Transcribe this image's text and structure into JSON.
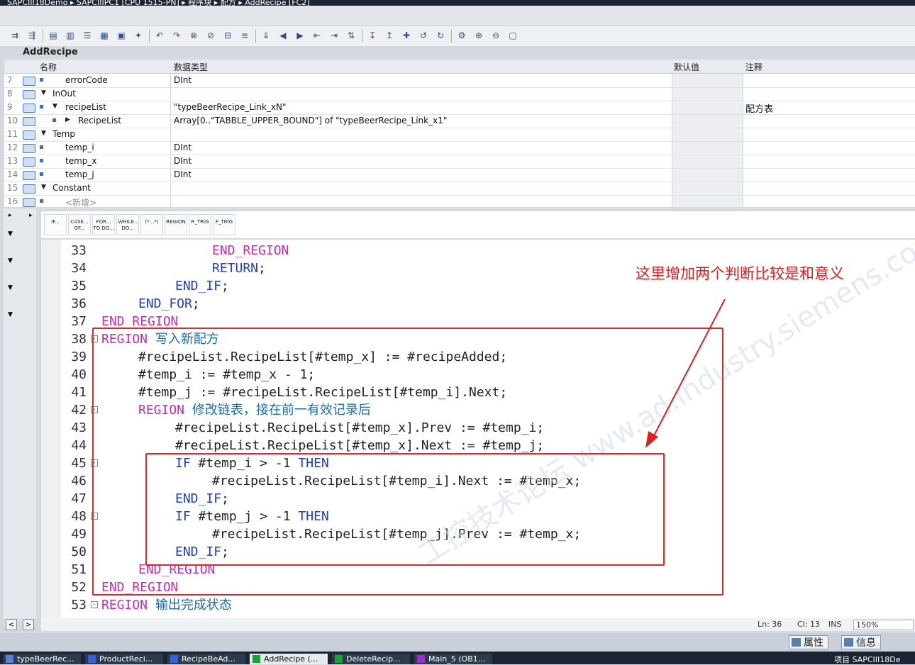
{
  "window_title": "SAPCIII18Demo ▸ SAPCIIIPC1 [CPU 1515-PN] ▸ 程序块 ▸ 配方 ▸ AddRecipe [FC2]",
  "block_name": "AddRecipe",
  "interface": {
    "headers": {
      "name": "名称",
      "datatype": "数据类型",
      "default": "默认值",
      "comment": "注释"
    },
    "rows": [
      {
        "num": "7",
        "name": "errorCode",
        "type": "DInt",
        "comment": "",
        "level": 2,
        "expand": ""
      },
      {
        "num": "8",
        "name": "InOut",
        "type": "",
        "comment": "",
        "level": 1,
        "expand": "down"
      },
      {
        "num": "9",
        "name": "recipeList",
        "type": "\"typeBeerRecipe_Link_xN\"",
        "comment": "配方表",
        "level": 2,
        "expand": "down"
      },
      {
        "num": "10",
        "name": "RecipeList",
        "type": "Array[0..\"TABBLE_UPPER_BOUND\"] of \"typeBeerRecipe_Link_x1\"",
        "comment": "",
        "level": 3,
        "expand": "right"
      },
      {
        "num": "11",
        "name": "Temp",
        "type": "",
        "comment": "",
        "level": 1,
        "expand": "down"
      },
      {
        "num": "12",
        "name": "temp_i",
        "type": "DInt",
        "comment": "",
        "level": 2,
        "expand": ""
      },
      {
        "num": "13",
        "name": "temp_x",
        "type": "DInt",
        "comment": "",
        "level": 2,
        "expand": ""
      },
      {
        "num": "14",
        "name": "temp_j",
        "type": "DInt",
        "comment": "",
        "level": 2,
        "expand": ""
      },
      {
        "num": "15",
        "name": "Constant",
        "type": "",
        "comment": "",
        "level": 1,
        "expand": "down"
      },
      {
        "num": "16",
        "name": "<新增>",
        "type": "",
        "comment": "",
        "level": 2,
        "expand": ""
      }
    ]
  },
  "scl_buttons": [
    {
      "top": "IF...",
      "bottom": ""
    },
    {
      "top": "CASE...",
      "bottom": "OF..."
    },
    {
      "top": "FOR...",
      "bottom": "TO DO..."
    },
    {
      "top": "WHILE..",
      "bottom": "DO..."
    },
    {
      "top": "(*...*)",
      "bottom": ""
    },
    {
      "top": "REGION",
      "bottom": ""
    },
    {
      "top": "R_TRIG",
      "bottom": ""
    },
    {
      "top": "F_TRIG",
      "bottom": ""
    }
  ],
  "code_lines": [
    {
      "ln": "33",
      "fold": "",
      "indent": 6,
      "parts": [
        [
          "rg",
          "END_REGION"
        ]
      ]
    },
    {
      "ln": "34",
      "fold": "",
      "indent": 6,
      "parts": [
        [
          "kw",
          "RETURN"
        ],
        [
          "t",
          ";"
        ]
      ]
    },
    {
      "ln": "35",
      "fold": "",
      "indent": 4,
      "parts": [
        [
          "kw",
          "END_IF"
        ],
        [
          "t",
          ";"
        ]
      ]
    },
    {
      "ln": "36",
      "fold": "",
      "indent": 2,
      "parts": [
        [
          "kw",
          "END_FOR"
        ],
        [
          "t",
          ";"
        ]
      ]
    },
    {
      "ln": "37",
      "fold": "",
      "indent": 0,
      "parts": [
        [
          "rg",
          "END_REGION"
        ]
      ]
    },
    {
      "ln": "38",
      "fold": "-",
      "indent": 0,
      "parts": [
        [
          "rg",
          "REGION "
        ],
        [
          "cm",
          "写入新配方"
        ]
      ]
    },
    {
      "ln": "39",
      "fold": "",
      "indent": 2,
      "parts": [
        [
          "t",
          "#recipeList.RecipeList[#temp_x] := #recipeAdded;"
        ]
      ]
    },
    {
      "ln": "40",
      "fold": "",
      "indent": 2,
      "parts": [
        [
          "t",
          "#temp_i := #temp_x - 1;"
        ]
      ]
    },
    {
      "ln": "41",
      "fold": "",
      "indent": 2,
      "parts": [
        [
          "t",
          "#temp_j := #recipeList.RecipeList[#temp_i].Next;"
        ]
      ]
    },
    {
      "ln": "42",
      "fold": "-",
      "indent": 2,
      "parts": [
        [
          "rg",
          "REGION "
        ],
        [
          "cm",
          "修改链表，接在前一有效记录后"
        ]
      ]
    },
    {
      "ln": "43",
      "fold": "",
      "indent": 4,
      "parts": [
        [
          "t",
          "#recipeList.RecipeList[#temp_x].Prev := #temp_i;"
        ]
      ]
    },
    {
      "ln": "44",
      "fold": "",
      "indent": 4,
      "parts": [
        [
          "t",
          "#recipeList.RecipeList[#temp_x].Next := #temp_j;"
        ]
      ]
    },
    {
      "ln": "45",
      "fold": "-",
      "indent": 4,
      "parts": [
        [
          "kw",
          "IF "
        ],
        [
          "t",
          "#temp_i > -1 "
        ],
        [
          "kw",
          "THEN"
        ]
      ]
    },
    {
      "ln": "46",
      "fold": "",
      "indent": 6,
      "parts": [
        [
          "t",
          "#recipeList.RecipeList[#temp_i].Next := #temp_x;"
        ]
      ]
    },
    {
      "ln": "47",
      "fold": "",
      "indent": 4,
      "parts": [
        [
          "kw",
          "END_IF"
        ],
        [
          "t",
          ";"
        ]
      ]
    },
    {
      "ln": "48",
      "fold": "-",
      "indent": 4,
      "parts": [
        [
          "kw",
          "IF "
        ],
        [
          "t",
          "#temp_j > -1 "
        ],
        [
          "kw",
          "THEN"
        ]
      ]
    },
    {
      "ln": "49",
      "fold": "",
      "indent": 6,
      "parts": [
        [
          "t",
          "#recipeList.RecipeList[#temp_j].Prev := #temp_x;"
        ]
      ]
    },
    {
      "ln": "50",
      "fold": "",
      "indent": 4,
      "parts": [
        [
          "kw",
          "END_IF"
        ],
        [
          "t",
          ";"
        ]
      ]
    },
    {
      "ln": "51",
      "fold": "",
      "indent": 2,
      "parts": [
        [
          "rg",
          "END_REGION"
        ]
      ]
    },
    {
      "ln": "52",
      "fold": "",
      "indent": 0,
      "parts": [
        [
          "rg",
          "END_REGION"
        ]
      ]
    },
    {
      "ln": "53",
      "fold": "-",
      "indent": 0,
      "parts": [
        [
          "rg",
          "REGION "
        ],
        [
          "cm",
          "输出完成状态"
        ]
      ]
    }
  ],
  "annotation": "这里增加两个判断比较是和意义",
  "watermark": "工控技术论坛  www.ad.industry.siemens.com/cs",
  "status": {
    "ln": "Ln: 36",
    "cl": "Cl: 13",
    "mode": "INS",
    "zoom": "150%"
  },
  "inspector_tabs": [
    "属性",
    "信息"
  ],
  "taskbar": [
    {
      "label": "typeBeerRec...",
      "color": "#5b7fd1"
    },
    {
      "label": "ProductReci...",
      "color": "#3c5fd0"
    },
    {
      "label": "RecipeBeAd...",
      "color": "#3c5fd0"
    },
    {
      "label": "AddRecipe (...",
      "color": "#1f9d3a"
    },
    {
      "label": "DeleteRecip...",
      "color": "#1f9d3a"
    },
    {
      "label": "Main_5 (OB1...",
      "color": "#9b33c2"
    }
  ],
  "taskbar_right": "项目 SAPCIII18De"
}
